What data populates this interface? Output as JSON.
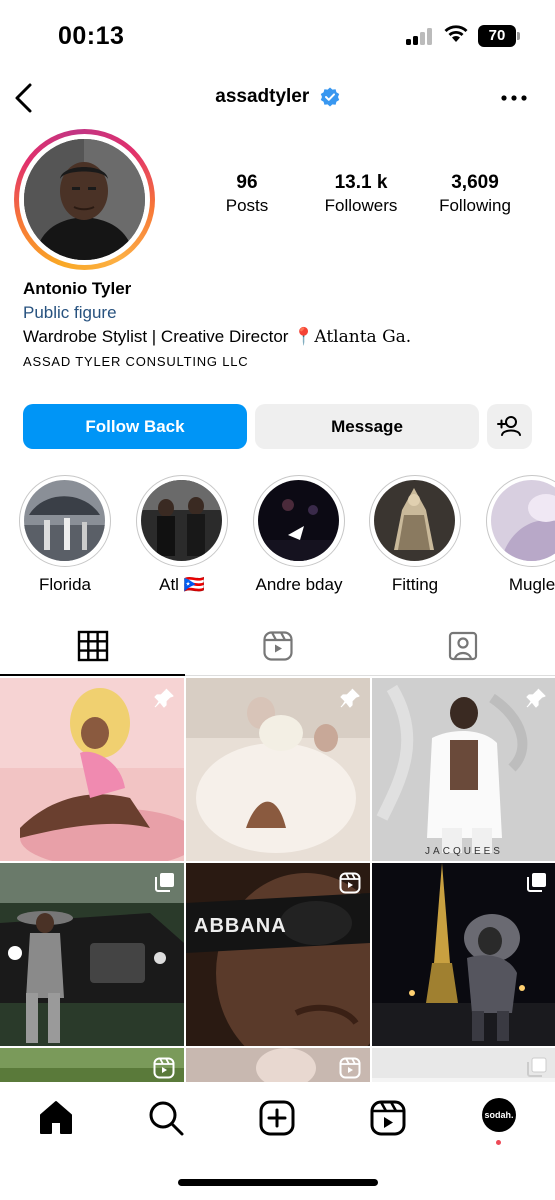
{
  "status_bar": {
    "time": "00:13",
    "battery": "70"
  },
  "header": {
    "username": "assadtyler"
  },
  "profile": {
    "stats": [
      {
        "value": "96",
        "label": "Posts"
      },
      {
        "value": "13.1 k",
        "label": "Followers"
      },
      {
        "value": "3,609",
        "label": "Following"
      }
    ],
    "name": "Antonio Tyler",
    "category": "Public figure",
    "bio_text": "Wardrobe Stylist | Creative Director",
    "bio_location": "Atlanta Ga.",
    "company": "ASSAD TYLER CONSULTING LLC"
  },
  "actions": {
    "follow_label": "Follow Back",
    "message_label": "Message"
  },
  "highlights": [
    {
      "label": "Florida"
    },
    {
      "label": "Atl 🇵🇷"
    },
    {
      "label": "Andre bday"
    },
    {
      "label": "Fitting"
    },
    {
      "label": "Mugle"
    }
  ],
  "grid_overlays": {
    "post3_text": "JACQUEES",
    "post5_text": "ABBANA"
  },
  "bottom_nav": {
    "avatar_text": "sodah."
  },
  "colors": {
    "accent": "#0095f6",
    "category_link": "#27527f",
    "notification_dot": "#ed4956"
  }
}
